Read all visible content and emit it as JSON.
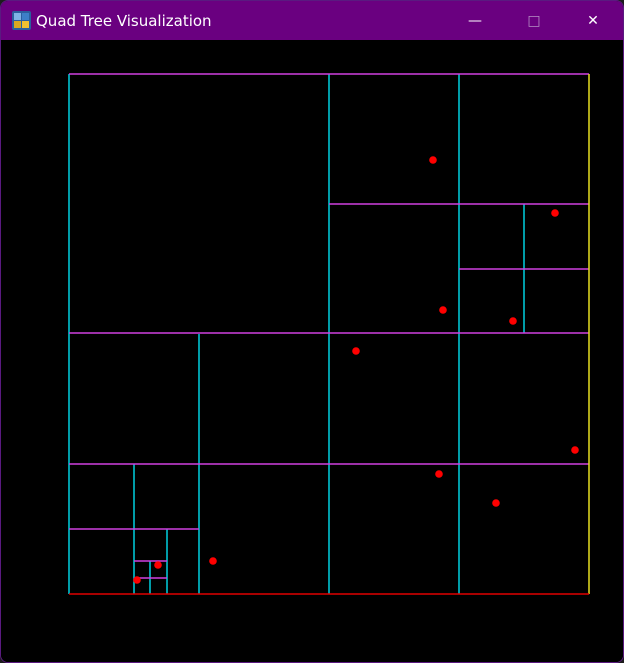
{
  "window": {
    "title": "Quad Tree Visualization",
    "app_icon": "python-icon",
    "controls": {
      "minimize_icon": "minimize-icon",
      "maximize_icon": "maximize-icon",
      "close_icon": "close-icon",
      "minimize_glyph": "—",
      "maximize_glyph": "□",
      "close_glyph": "✕"
    }
  },
  "colors": {
    "titlebar": "#6a0080",
    "background": "#000000",
    "vertical_divider": "#00d0e0",
    "horizontal_divider": "#d040e0",
    "right_boundary": "#e8e020",
    "bottom_boundary": "#e00000",
    "point": "#ff0000"
  }
}
